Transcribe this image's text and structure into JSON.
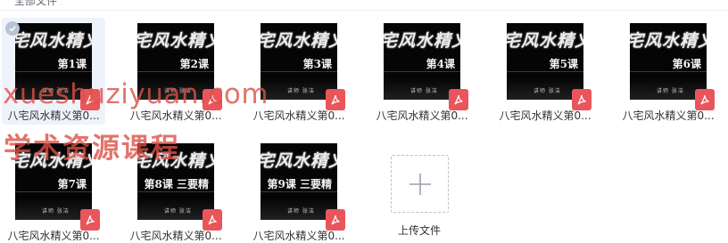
{
  "header": {
    "breadcrumb": "全部文件"
  },
  "files": [
    {
      "name": "八宅风水精义第0...",
      "thumb_title": "宅风水精义",
      "thumb_lesson": "第1课",
      "thumb_author": "讲师 张洁",
      "type": "pdf",
      "selected": true
    },
    {
      "name": "八宅风水精义第0...",
      "thumb_title": "宅风水精义",
      "thumb_lesson": "第2课",
      "thumb_author": "讲师 张洁",
      "type": "pdf",
      "selected": false
    },
    {
      "name": "八宅风水精义第0...",
      "thumb_title": "宅风水精义",
      "thumb_lesson": "第3课",
      "thumb_author": "讲师 张洁",
      "type": "pdf",
      "selected": false
    },
    {
      "name": "八宅风水精义第0...",
      "thumb_title": "宅风水精义",
      "thumb_lesson": "第4课",
      "thumb_author": "讲师 张洁",
      "type": "pdf",
      "selected": false
    },
    {
      "name": "八宅风水精义第0...",
      "thumb_title": "宅风水精义",
      "thumb_lesson": "第5课",
      "thumb_author": "讲师 张洁",
      "type": "pdf",
      "selected": false
    },
    {
      "name": "八宅风水精义第0...",
      "thumb_title": "宅风水精义",
      "thumb_lesson": "第6课",
      "thumb_author": "讲师 张洁",
      "type": "pdf",
      "selected": false
    },
    {
      "name": "八宅风水精义第0...",
      "thumb_title": "宅风水精义",
      "thumb_lesson": "第7课",
      "thumb_author": "讲师 张洁",
      "type": "pdf",
      "selected": false
    },
    {
      "name": "八宅风水精义第0...",
      "thumb_title": "宅风水精义",
      "thumb_lesson": "第8课 三要精",
      "thumb_author": "讲师 张洁",
      "type": "pdf",
      "selected": false
    },
    {
      "name": "八宅风水精义第0...",
      "thumb_title": "宅风水精义",
      "thumb_lesson": "第9课 三要精",
      "thumb_author": "讲师 张洁",
      "type": "pdf",
      "selected": false
    }
  ],
  "upload": {
    "label": "上传文件",
    "icon": "plus-icon"
  },
  "watermark": {
    "line1": "xueshuziyuan.com",
    "line2": "学术资源课程"
  },
  "colors": {
    "pdf_badge": "#e9555b",
    "selected_bg": "#eef3fb",
    "watermark": "#dc5046"
  }
}
